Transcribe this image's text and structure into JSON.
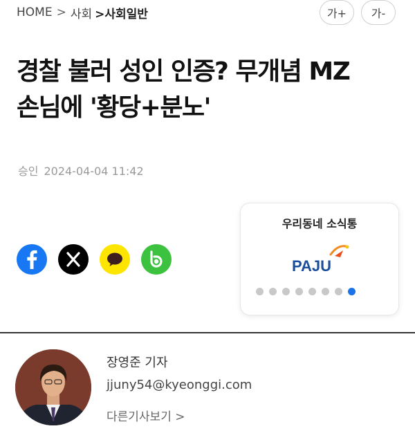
{
  "breadcrumb": {
    "home": "HOME",
    "sep": ">",
    "section": "사회",
    "current": ">사회일반"
  },
  "font_controls": {
    "increase": "가+",
    "decrease": "가-"
  },
  "article": {
    "headline_line1": "경찰 불러 성인 인증? 무개념 MZ",
    "headline_line2": "손님에 '황당+분노'",
    "status": "승인",
    "datetime": "2024-04-04 11:42"
  },
  "share": {
    "icons": [
      "facebook-icon",
      "x-icon",
      "kakaotalk-icon",
      "band-icon"
    ]
  },
  "local_news": {
    "title": "우리동네 소식통",
    "logo_text": "PAJU",
    "page_count": 8,
    "active_page": 8
  },
  "author": {
    "name": "장영준 기자",
    "email": "jjuny54@kyeonggi.com",
    "more_link": "다른기사보기 >"
  },
  "colors": {
    "facebook": "#1877f2",
    "x": "#000000",
    "kakao": "#fee500",
    "band": "#3dc23f",
    "active_dot": "#1a73e8"
  }
}
